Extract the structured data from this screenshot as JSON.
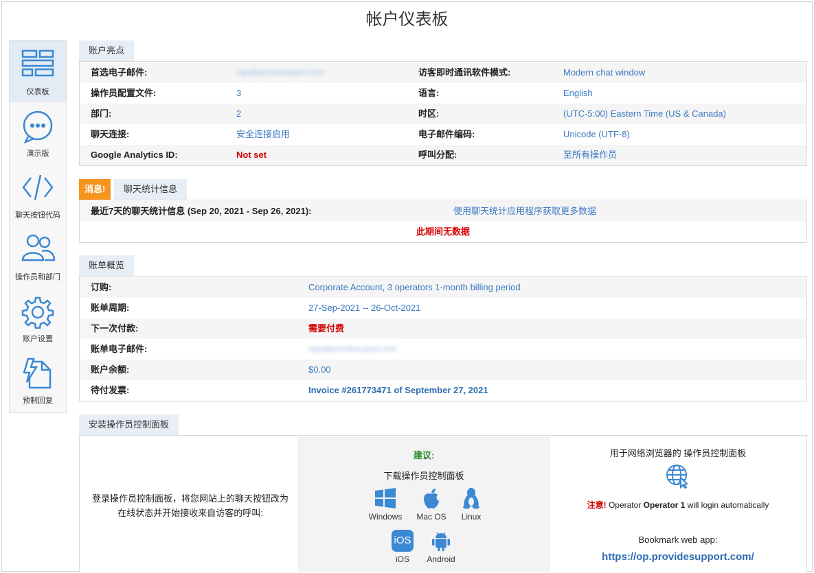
{
  "page": {
    "title": "帐户仪表板"
  },
  "sidebar": {
    "items": [
      {
        "label": "仪表板",
        "icon": "dashboard-icon",
        "active": true
      },
      {
        "label": "演示版",
        "icon": "chat-bubble-icon",
        "active": false
      },
      {
        "label": "聊天按钮代码",
        "icon": "code-icon",
        "active": false
      },
      {
        "label": "操作员和部门",
        "icon": "users-icon",
        "active": false
      },
      {
        "label": "账户设置",
        "icon": "gear-icon",
        "active": false
      },
      {
        "label": "预制回复",
        "icon": "canned-reply-icon",
        "active": false
      }
    ]
  },
  "highlights": {
    "tab": "账户亮点",
    "rows": [
      {
        "l1": "首选电子邮件:",
        "v1": "olga@providesupport.com",
        "l2": "访客即时通讯软件模式:",
        "v2": "Modern chat window"
      },
      {
        "l1": "操作员配置文件:",
        "v1": "3",
        "l2": "语言:",
        "v2": "English"
      },
      {
        "l1": "部门:",
        "v1": "2",
        "l2": "时区:",
        "v2": "(UTC-5:00) Eastern Time (US & Canada)"
      },
      {
        "l1": "聊天连接:",
        "v1": "安全连接启用",
        "l2": "电子邮件编码:",
        "v2": "Unicode (UTF-8)"
      },
      {
        "l1": "Google Analytics ID:",
        "v1": "Not set",
        "l2": "呼叫分配:",
        "v2": "至所有操作员"
      }
    ]
  },
  "stats": {
    "alert_tab": "消息!",
    "tab": "聊天统计信息",
    "label": "最近7天的聊天统计信息 (Sep 20, 2021 - Sep 26, 2021):",
    "link": "使用聊天统计应用程序获取更多数据",
    "no_data": "此期间无数据"
  },
  "billing": {
    "tab": "账单概览",
    "rows": [
      {
        "label": "订购:",
        "value": "Corporate Account, 3 operators 1-month billing period"
      },
      {
        "label": "账单周期:",
        "value": "27-Sep-2021 -- 26-Oct-2021"
      },
      {
        "label": "下一次付款:",
        "value": "需要付费"
      },
      {
        "label": "账单电子邮件:",
        "value": "olga@providesupport.com"
      },
      {
        "label": "账户余额:",
        "value": "$0.00"
      },
      {
        "label": "待付发票:",
        "value": "Invoice #261773471 of September 27, 2021"
      }
    ]
  },
  "install": {
    "tab": "安装操作员控制面板",
    "left_text": "登录操作员控制面板，将您网站上的聊天按钮改为在线状态并开始接收来自访客的呼叫:",
    "recommend": "建议:",
    "download": "下载操作员控制面板",
    "platforms": [
      "Windows",
      "Mac OS",
      "Linux",
      "iOS",
      "Android"
    ],
    "ios_badge": "iOS",
    "web_title": "用于网络浏览器的 操作员控制面板",
    "note_label": "注意!",
    "note_pre": "Operator",
    "note_name": "Operator 1",
    "note_post": "will login automatically",
    "bookmark": "Bookmark web app:",
    "url": "https://op.providesupport.com/"
  },
  "colors": {
    "link": "#3b78c2",
    "alert": "#f7941e",
    "error": "#d40000",
    "green": "#2e8b2e"
  }
}
